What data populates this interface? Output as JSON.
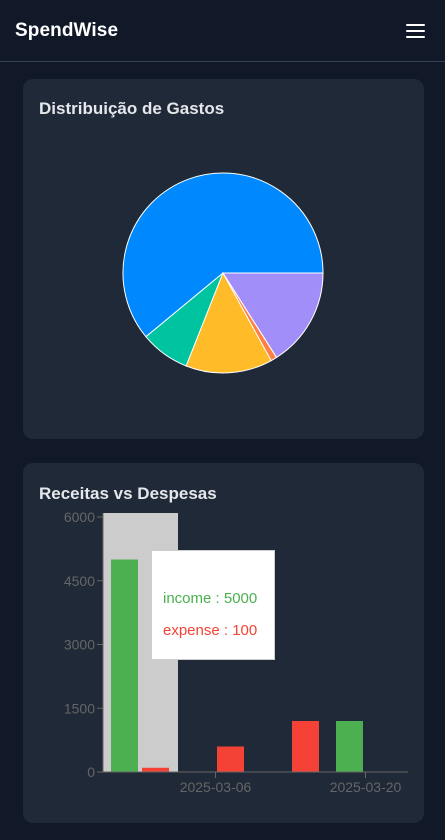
{
  "app": {
    "brand": "SpendWise"
  },
  "pie_card": {
    "title": "Distribuição de Gastos"
  },
  "bar_card": {
    "title": "Receitas vs Despesas"
  },
  "tooltip": {
    "income_label": "income : 5000",
    "expense_label": "expense : 100",
    "income_color": "#4caf50",
    "expense_color": "#f44336"
  },
  "chart_data": [
    {
      "type": "pie",
      "title": "",
      "slices": [
        {
          "value": 61,
          "color": "#0088fe"
        },
        {
          "value": 8,
          "color": "#00c49f"
        },
        {
          "value": 14,
          "color": "#ffbb28"
        },
        {
          "value": 1,
          "color": "#ff8042"
        },
        {
          "value": 16,
          "color": "#a28ef9"
        }
      ]
    },
    {
      "type": "bar",
      "title": "",
      "categories": [
        "",
        "2025-03-06",
        "",
        "2025-03-20"
      ],
      "series": [
        {
          "name": "income",
          "color": "#4caf50",
          "values": [
            5000,
            0,
            0,
            1200
          ]
        },
        {
          "name": "expense",
          "color": "#f44336",
          "values": [
            100,
            600,
            1200,
            0
          ]
        }
      ],
      "ylim": [
        0,
        6000
      ],
      "yticks": [
        "0",
        "1500",
        "3000",
        "4500",
        "6000"
      ],
      "highlighted_category": 0,
      "grid": false,
      "legend": "none"
    }
  ]
}
